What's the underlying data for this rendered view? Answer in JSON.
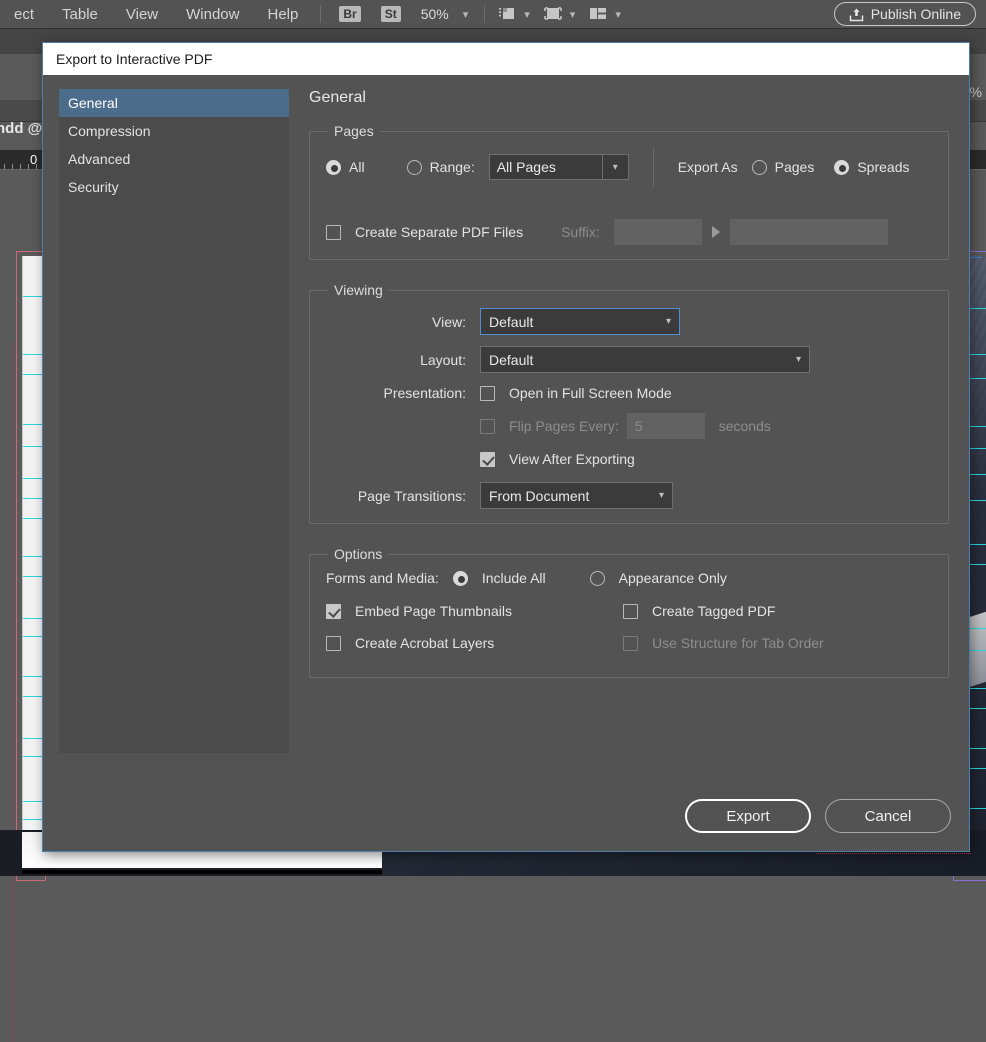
{
  "app": {
    "menus": [
      "ect",
      "Table",
      "View",
      "Window",
      "Help"
    ],
    "badges": [
      "Br",
      "St"
    ],
    "zoom_level": "50%",
    "publish_label": "Publish Online",
    "zoom_right": "%",
    "document_tab": "ndd @",
    "ruler_zero": "0"
  },
  "dialog": {
    "title": "Export to Interactive PDF",
    "sidebar": {
      "items": [
        {
          "label": "General",
          "selected": true
        },
        {
          "label": "Compression",
          "selected": false
        },
        {
          "label": "Advanced",
          "selected": false
        },
        {
          "label": "Security",
          "selected": false
        }
      ]
    },
    "main": {
      "title": "General",
      "pages": {
        "legend": "Pages",
        "all_label": "All",
        "all_selected": true,
        "range_label": "Range:",
        "range_selected": false,
        "range_value": "All Pages",
        "export_as_label": "Export As",
        "export_as_pages": "Pages",
        "export_as_spreads": "Spreads",
        "export_as_value": "Spreads",
        "create_separate_label": "Create Separate PDF Files",
        "create_separate_checked": false,
        "suffix_label": "Suffix:",
        "suffix_value": "",
        "suffix_value_2": ""
      },
      "viewing": {
        "legend": "Viewing",
        "view_label": "View:",
        "view_value": "Default",
        "layout_label": "Layout:",
        "layout_value": "Default",
        "presentation_label": "Presentation:",
        "fullscreen_label": "Open in Full Screen Mode",
        "fullscreen_checked": false,
        "flip_label": "Flip Pages Every:",
        "flip_checked": false,
        "flip_value": "5",
        "seconds_label": "seconds",
        "view_after_label": "View After Exporting",
        "view_after_checked": true,
        "page_transitions_label": "Page Transitions:",
        "page_transitions_value": "From Document"
      },
      "options": {
        "legend": "Options",
        "forms_label": "Forms and Media:",
        "include_all_label": "Include All",
        "appearance_only_label": "Appearance Only",
        "forms_value": "Include All",
        "embed_thumbs_label": "Embed Page Thumbnails",
        "embed_thumbs_checked": true,
        "tagged_pdf_label": "Create Tagged PDF",
        "tagged_pdf_checked": false,
        "acrobat_layers_label": "Create Acrobat Layers",
        "acrobat_layers_checked": false,
        "tab_order_label": "Use Structure for Tab Order",
        "tab_order_checked": false
      }
    },
    "footer": {
      "export_label": "Export",
      "cancel_label": "Cancel"
    }
  },
  "colors": {
    "dialog_bg": "#535353",
    "sidebar_bg": "#4b4b4b",
    "sidebar_selected": "#4b6c8a",
    "titlebar_bg": "#ffffff",
    "focus_border": "#4f8fd0",
    "guide_cyan": "#2ad7e0",
    "margin_pink": "#c9697a"
  }
}
